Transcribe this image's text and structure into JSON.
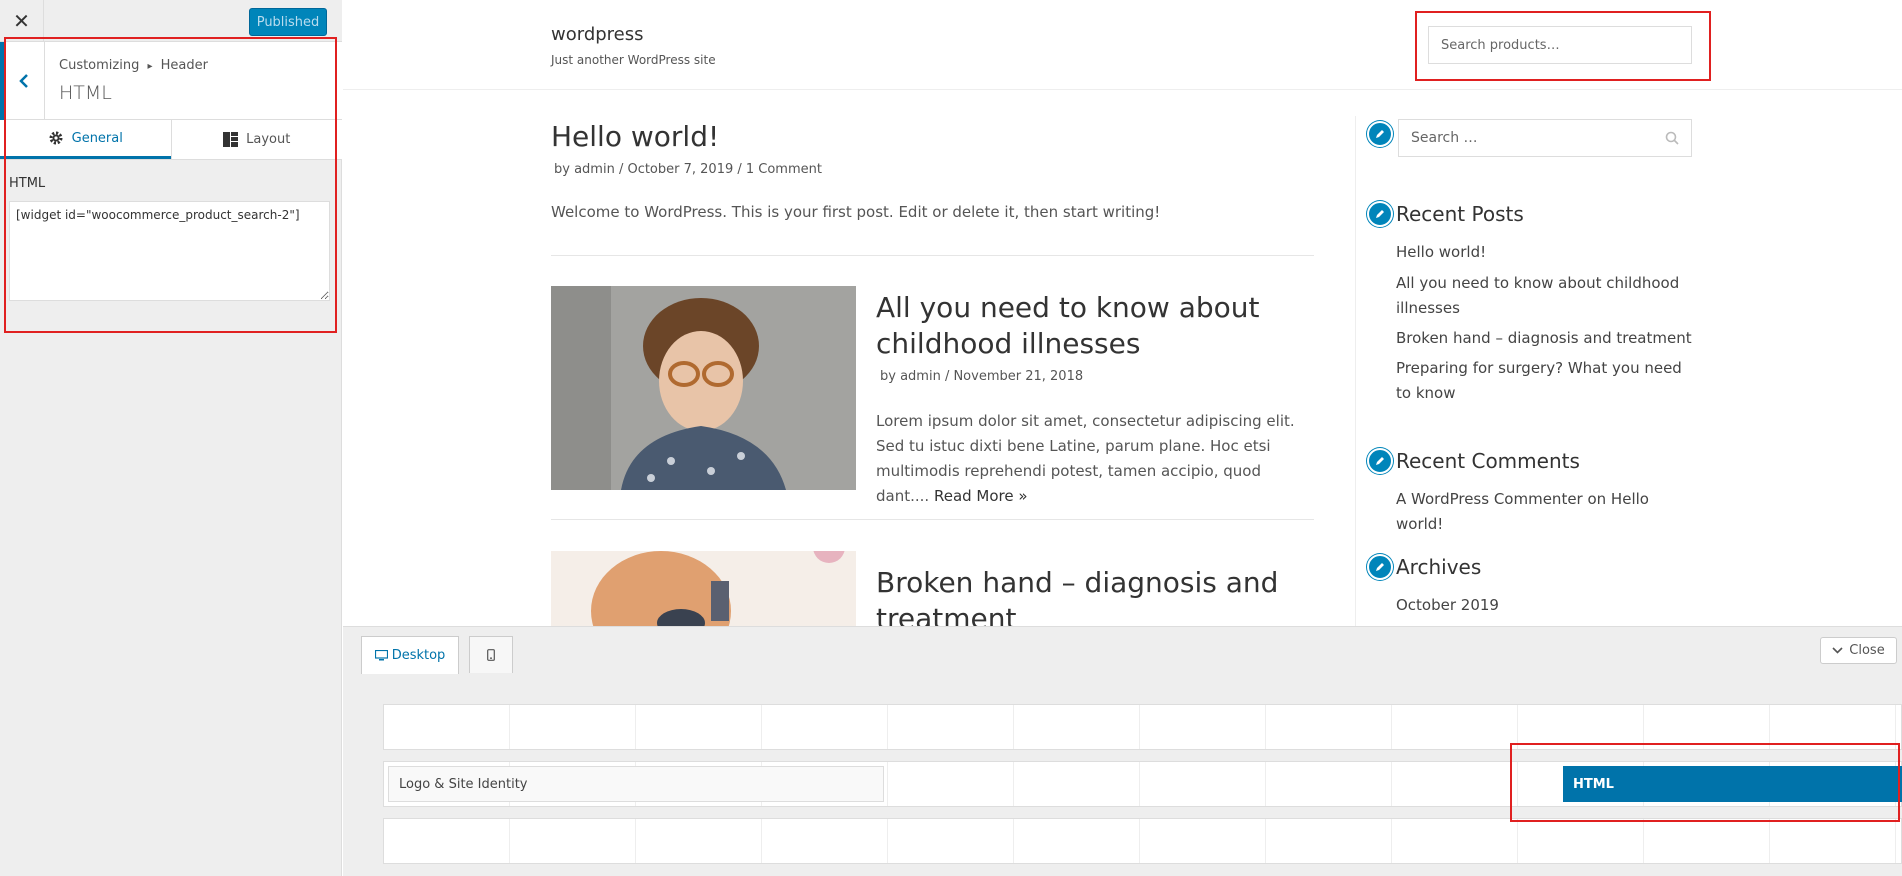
{
  "sidebar": {
    "close_icon": "close-icon",
    "publish_label": "Published",
    "breadcrumb_root": "Customizing",
    "breadcrumb_sep": "▸",
    "breadcrumb_section": "Header",
    "section_title": "HTML",
    "tabs": [
      {
        "label": "General",
        "icon": "gear-icon",
        "active": true
      },
      {
        "label": "Layout",
        "icon": "layout-icon",
        "active": false
      }
    ],
    "html_label": "HTML",
    "html_value": "[widget id=\"woocommerce_product_search-2\"]"
  },
  "preview": {
    "site_name": "wordpress",
    "site_tagline": "Just another WordPress site",
    "header_search_placeholder": "Search products…",
    "post1": {
      "title": "Hello world!",
      "meta": "by admin  /  October 7, 2019  /  1 Comment",
      "excerpt": "Welcome to WordPress. This is your first post. Edit or delete it, then start writing!"
    },
    "post2": {
      "title": "All you need to know about childhood illnesses",
      "meta": "by admin  /  November 21, 2018",
      "excerpt": "Lorem ipsum dolor sit amet, consectetur adipiscing elit. Sed tu istuc dixti bene Latine, parum plane. Hoc etsi multimodis reprehendi potest, tamen accipio, quod dant....",
      "read_more": "Read More »"
    },
    "post3": {
      "title": "Broken hand – diagnosis and treatment"
    },
    "sidebar_search_placeholder": "Search …",
    "recent_posts": {
      "title": "Recent Posts",
      "items": [
        "Hello world!",
        "All you need to know about childhood illnesses",
        "Broken hand – diagnosis and treatment",
        "Preparing for surgery? What you need to know"
      ]
    },
    "recent_comments": {
      "title": "Recent Comments",
      "items": [
        "A WordPress Commenter on Hello world!"
      ]
    },
    "archives": {
      "title": "Archives",
      "items": [
        "October 2019"
      ]
    }
  },
  "builder": {
    "desktop_label": "Desktop",
    "mobile_icon": "mobile-icon",
    "close_label": "Close",
    "logo_item": "Logo & Site Identity",
    "html_item": "HTML"
  },
  "colors": {
    "accent": "#0073aa",
    "publish": "#0085ba",
    "highlight": "#e02020"
  }
}
